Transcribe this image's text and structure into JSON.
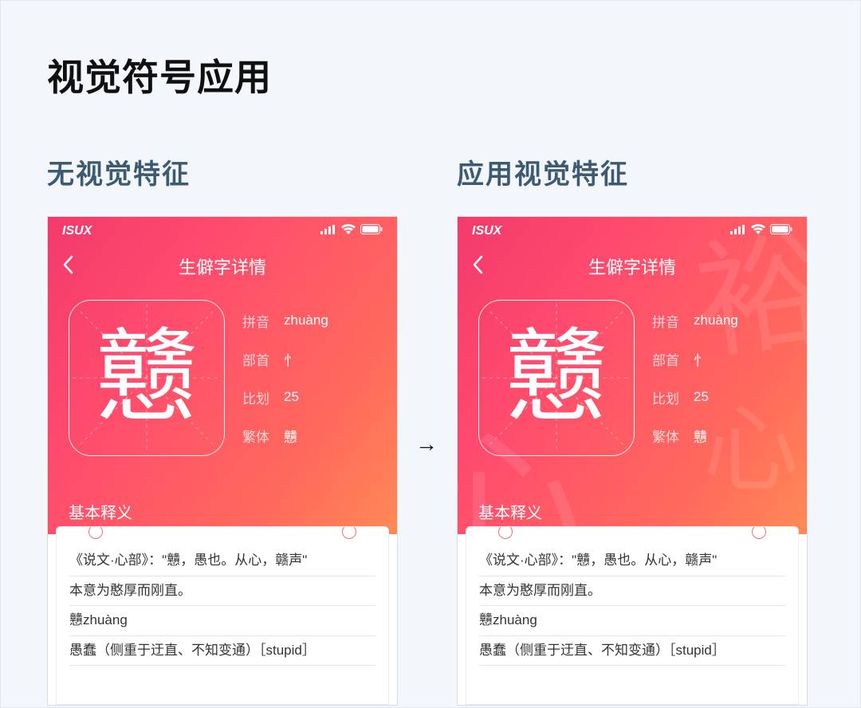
{
  "title": "视觉符号应用",
  "subtitle_left": "无视觉特征",
  "subtitle_right": "应用视觉特征",
  "compare_arrow": "→",
  "carrier": "ISUX",
  "nav_title": "生僻字详情",
  "char": "戆",
  "props": {
    "pinyin_label": "拼音",
    "pinyin_value": "zhuàng",
    "radical_label": "部首",
    "radical_value": "忄",
    "strokes_label": "比划",
    "strokes_value": "25",
    "traditional_label": "繁体",
    "traditional_value": "戇"
  },
  "section_label": "基本释义",
  "def_lines": [
    "《说文·心部》：\"戇，愚也。从心，赣声\"",
    "本意为憨厚而刚直。",
    "戇zhuàng",
    "愚蠢（侧重于迂直、不知变通）［stupid］"
  ],
  "bg_glyphs": [
    "裕",
    "心",
    "心"
  ]
}
